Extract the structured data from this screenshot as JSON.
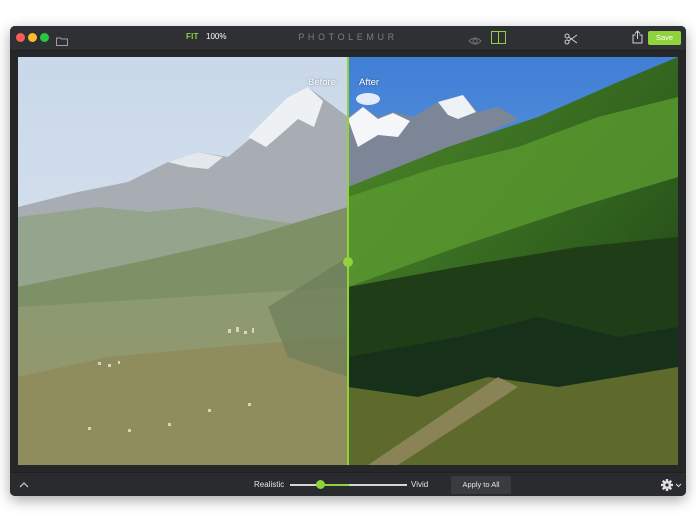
{
  "titlebar": {
    "fit_label": "FIT",
    "zoom_label": "100%",
    "app_title": "PHOTOLEMUR",
    "save_label": "Save"
  },
  "canvas": {
    "before_label": "Before",
    "after_label": "After"
  },
  "bottombar": {
    "realistic_label": "Realistic",
    "vivid_label": "Vivid",
    "apply_label": "Apply to All",
    "intensity_fraction": 0.26
  },
  "colors": {
    "accent": "#8fd23c",
    "window_bg": "#2b2c2f",
    "button_bg": "#3a3b3e"
  },
  "icons": {
    "folder": "folder-icon",
    "eye": "eye-icon",
    "compare": "compare-icon",
    "scissors": "scissors-icon",
    "share": "share-icon",
    "chevron": "chevron-up-icon",
    "gear": "gear-icon"
  }
}
